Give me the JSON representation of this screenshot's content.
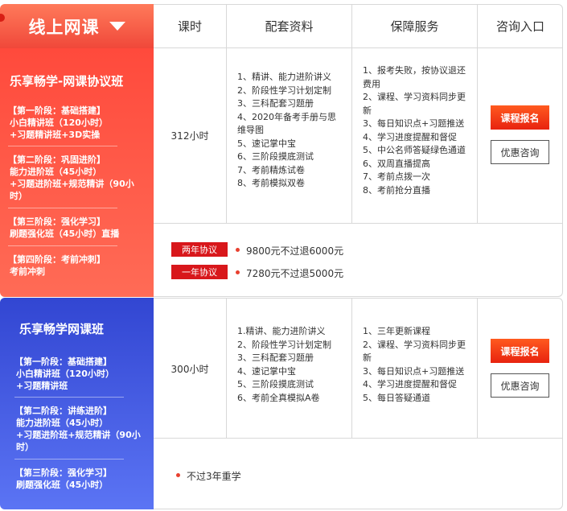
{
  "header": {
    "tab_label": "线上网课",
    "columns": [
      "课时",
      "配套资料",
      "保障服务",
      "咨询入口"
    ]
  },
  "courses": [
    {
      "title": "乐享畅学-网课协议班",
      "stages": [
        {
          "label": "【第一阶段：基础搭建】",
          "lines": [
            "小白精讲班（120小时）",
            "+习题精讲班+3D实操"
          ]
        },
        {
          "label": "【第二阶段：巩固进阶】",
          "lines": [
            "能力进阶班（45小时）",
            "+习题进阶班+规范精讲（90小",
            "时）"
          ]
        },
        {
          "label": "【第三阶段：强化学习】",
          "lines": [
            "刷题强化班（45小时）直播"
          ]
        },
        {
          "label": "【第四阶段：考前冲刺】",
          "lines": [
            "考前冲刺"
          ]
        }
      ],
      "hours": "312小时",
      "materials": [
        "1、精讲、能力进阶讲义",
        "2、阶段性学习计划定制",
        "3、三科配套习题册",
        "4、2020年备考手册与思",
        "维导图",
        "5、速记掌中宝",
        "6、三阶段摸底测试",
        "7、考前精炼试卷",
        "8、考前模拟双卷"
      ],
      "services": [
        "1、报考失败，按协议退还",
        "费用",
        "2、课程、学习资料同步更",
        "新",
        "3、每日知识点+习题推送",
        "4、学习进度提醒和督促",
        "5、中公名师答疑绿色通道",
        "6、双周直播提高",
        "7、考前点拨一次",
        "8、考前抢分直播"
      ],
      "register_label": "课程报名",
      "consult_label": "优惠咨询",
      "agreements": [
        {
          "tag": "两年协议",
          "text": "9800元不过退6000元"
        },
        {
          "tag": "一年协议",
          "text": "7280元不过退5000元"
        }
      ]
    },
    {
      "title": "乐享畅学网课班",
      "stages": [
        {
          "label": "【第一阶段：基础搭建】",
          "lines": [
            "小白精讲班（120小时）",
            "+习题精讲班"
          ]
        },
        {
          "label": "【第二阶段：讲练进阶】",
          "lines": [
            "能力进阶班（45小时）",
            "+习题进阶班+规范精讲（90小",
            "时）"
          ]
        },
        {
          "label": "【第三阶段：强化学习】",
          "lines": [
            "刷题强化班（45小时）"
          ]
        }
      ],
      "hours": "300小时",
      "materials": [
        "1.精讲、能力进阶讲义",
        "2、阶段性学习计划定制",
        "3、三科配套习题册",
        "4、速记掌中宝",
        "5、三阶段摸底测试",
        "6、考前全真模拟A卷"
      ],
      "services": [
        "1、三年更新课程",
        "2、课程、学习资料同步更",
        "新",
        "3、每日知识点+习题推送",
        "4、学习进度提醒和督促",
        "5、每日答疑通道"
      ],
      "register_label": "课程报名",
      "consult_label": "优惠咨询",
      "note": "不过3年重学"
    }
  ]
}
